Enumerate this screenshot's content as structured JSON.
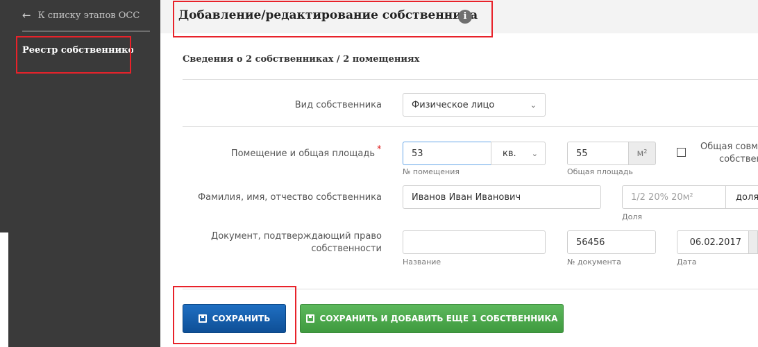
{
  "sidebar": {
    "back_arrow": "←",
    "back_label": "К списку этапов ОСС",
    "registry_label": "Реестр собственников"
  },
  "header": {
    "title": "Добавление/редактирование собственника",
    "info_glyph": "i"
  },
  "summary": "Сведения о 2 собственниках / 2 помещениях",
  "form": {
    "owner_type": {
      "label": "Вид собственника",
      "value": "Физическое лицо"
    },
    "premises": {
      "label": "Помещение и общая площадь",
      "required_mark": "*",
      "number_value": "53",
      "number_hint": "№ помещения",
      "unit_value": "кв.",
      "area_value": "55",
      "area_unit": "м²",
      "area_hint": "Общая площадь",
      "joint_label_line1": "Общая совме",
      "joint_label_line2": "собствен"
    },
    "owner_name": {
      "label": "Фамилия, имя, отчество собственника",
      "value": "Иванов Иван Иванович",
      "share_placeholder": "1/2 20% 20м²",
      "share_hint": "Доля",
      "share_type_value": "доля"
    },
    "document": {
      "label_line1": "Документ, подтверждающий право",
      "label_line2": "собственности",
      "name_value": "",
      "name_hint": "Название",
      "number_value": "56456",
      "number_hint": "№ документа",
      "date_value": "06.02.2017",
      "date_hint": "Дата"
    }
  },
  "buttons": {
    "save": "СОХРАНИТЬ",
    "save_add": "СОХРАНИТЬ И ДОБАВИТЬ ЕЩЕ 1 СОБСТВЕННИКА"
  },
  "icons": {
    "chevron": "⌄"
  },
  "colors": {
    "highlight": "#e8222a",
    "save_button": "#1565b8",
    "save_add_button": "#4cae4c",
    "sidebar": "#3a3a3a"
  }
}
